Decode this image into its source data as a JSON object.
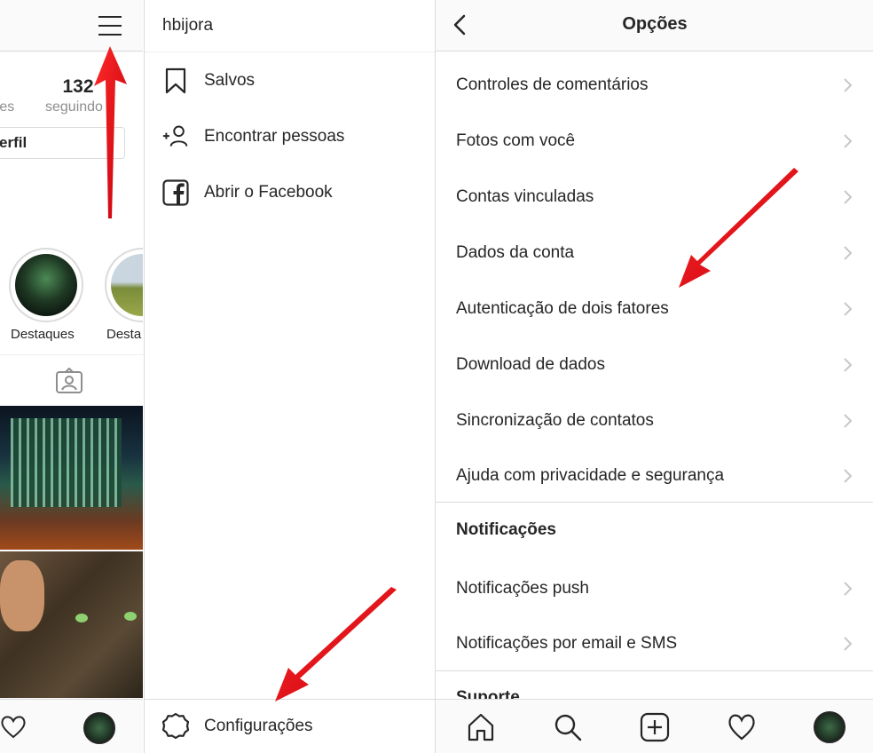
{
  "profile": {
    "following_count": "132",
    "followers_label": "res",
    "following_label": "seguindo",
    "edit_profile_label": "erfil",
    "highlights": [
      {
        "label": "Destaques"
      },
      {
        "label": "Desta"
      }
    ]
  },
  "menu": {
    "username": "hbijora",
    "items": [
      {
        "label": "Salvos",
        "icon": "bookmark-icon"
      },
      {
        "label": "Encontrar pessoas",
        "icon": "add-person-icon"
      },
      {
        "label": "Abrir o Facebook",
        "icon": "facebook-icon"
      }
    ],
    "settings_label": "Configurações",
    "settings_icon": "gear-icon"
  },
  "options": {
    "title": "Opções",
    "items": [
      {
        "label": "Controles de comentários"
      },
      {
        "label": "Fotos com você"
      },
      {
        "label": "Contas vinculadas"
      },
      {
        "label": "Dados da conta"
      },
      {
        "label": "Autenticação de dois fatores"
      },
      {
        "label": "Download de dados"
      },
      {
        "label": "Sincronização de contatos"
      },
      {
        "label": "Ajuda com privacidade e segurança"
      }
    ],
    "notifications_section": "Notificações",
    "notifications_items": [
      {
        "label": "Notificações push"
      },
      {
        "label": "Notificações por email e SMS"
      }
    ],
    "support_section": "Suporte"
  },
  "colors": {
    "text": "#262626",
    "secondary_text": "#8e8e8e",
    "divider": "#dbdbdb",
    "arrow_red": "#e0121b"
  }
}
